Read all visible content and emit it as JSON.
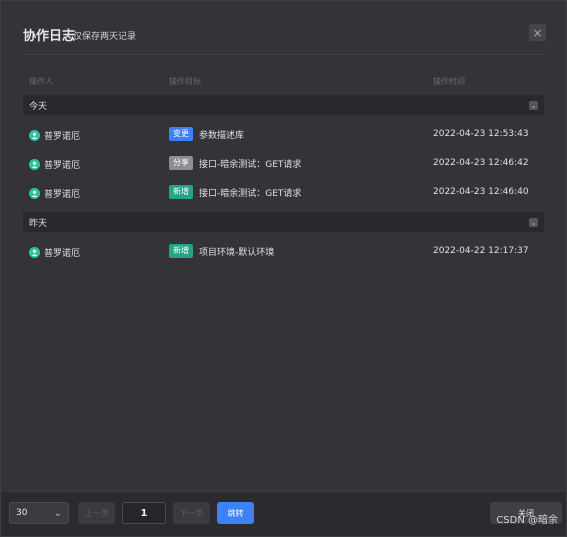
{
  "header": {
    "title": "协作日志",
    "subtitle": "仅保存两天记录",
    "close_icon": "×"
  },
  "columns": {
    "operator": "操作人",
    "target": "操作目标",
    "time": "操作时间"
  },
  "groups": [
    {
      "title": "今天",
      "rows": [
        {
          "user": "普罗诺厄",
          "tag": "变更",
          "tag_color": "#3b82f6",
          "target": "参数描述库",
          "time": "2022-04-23 12:53:43"
        },
        {
          "user": "普罗诺厄",
          "tag": "分享",
          "tag_color": "#8d8d94",
          "target": "接口-暗余测试：GET请求",
          "time": "2022-04-23 12:46:42"
        },
        {
          "user": "普罗诺厄",
          "tag": "新增",
          "tag_color": "#23a486",
          "target": "接口-暗余测试：GET请求",
          "time": "2022-04-23 12:46:40"
        }
      ]
    },
    {
      "title": "昨天",
      "rows": [
        {
          "user": "普罗诺厄",
          "tag": "新增",
          "tag_color": "#23a486",
          "target": "项目环境-默认环境",
          "time": "2022-04-22 12:17:37"
        }
      ]
    }
  ],
  "footer": {
    "page_size": "30",
    "prev_label": "上一页",
    "page_number": "1",
    "next_label": "下一页",
    "go_label": "跳转",
    "close_label": "关闭",
    "watermark": "CSDN @暗余"
  },
  "colors": {
    "accent": "#3b82f6",
    "avatar": "#2ec4a1"
  }
}
